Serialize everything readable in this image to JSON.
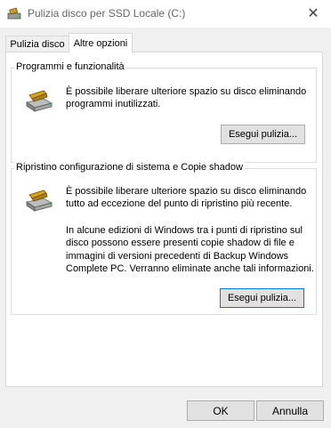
{
  "window": {
    "title": "Pulizia disco per SSD Locale (C:)",
    "close_glyph": "✕"
  },
  "tabs": [
    {
      "label": "Pulizia disco",
      "active": false
    },
    {
      "label": "Altre opzioni",
      "active": true
    }
  ],
  "groups": {
    "programs": {
      "title": "Programmi e funzionalità",
      "description": "È possibile liberare ulteriore spazio su disco eliminando\nprogrammi inutilizzati.",
      "button_label": "Esegui pulizia..."
    },
    "restore": {
      "title": "Ripristino configurazione di sistema e Copie shadow",
      "description": "È possibile liberare ulteriore spazio su disco eliminando\ntutto ad eccezione del punto di ripristino più recente.",
      "note": "In alcune edizioni di Windows tra i punti di ripristino sul\ndisco possono essere presenti copie shadow di file e\nimmagini di versioni precedenti di Backup Windows\nComplete PC. Verranno eliminate anche tali informazioni.",
      "button_label": "Esegui pulizia..."
    }
  },
  "footer": {
    "ok_label": "OK",
    "cancel_label": "Annulla"
  },
  "colors": {
    "focus_border": "#0078d7",
    "button_bg": "#e1e1e1"
  }
}
